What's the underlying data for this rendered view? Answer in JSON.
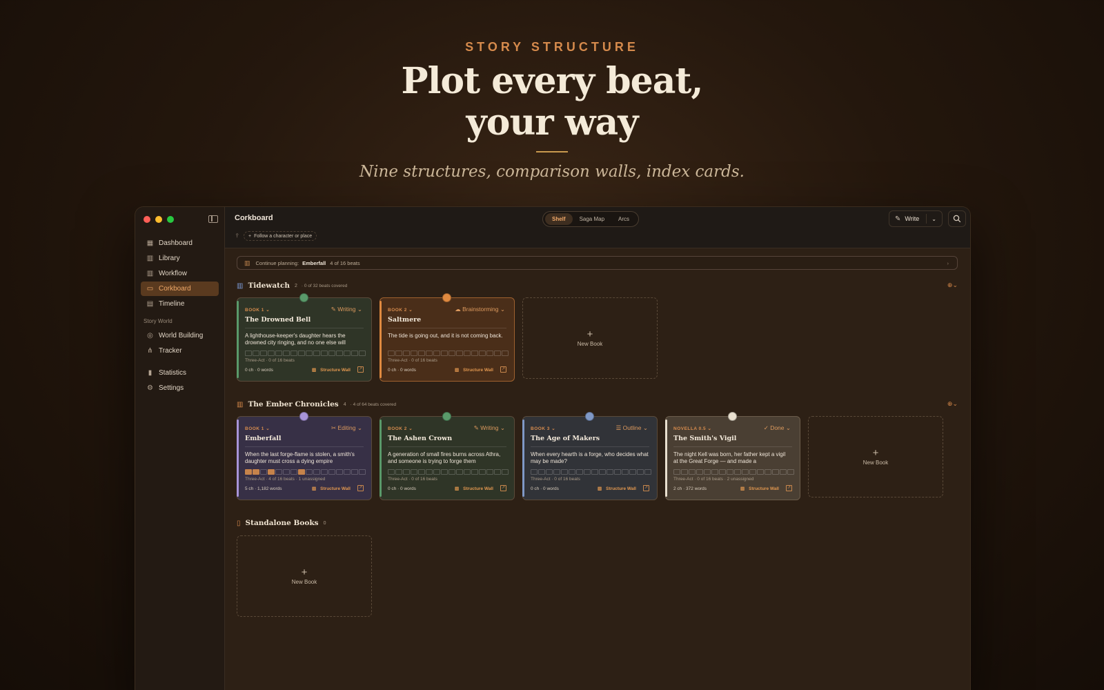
{
  "hero": {
    "eyebrow": "STORY STRUCTURE",
    "headline_line1": "Plot every beat,",
    "headline_line2": "your way",
    "tagline": "Nine structures, comparison walls, index cards."
  },
  "colors": {
    "accent": "#d58a4c",
    "traffic_red": "#ff5f57",
    "traffic_yellow": "#febc2e",
    "traffic_green": "#28c840"
  },
  "sidebar": {
    "items": [
      {
        "label": "Dashboard",
        "icon": "grid-icon"
      },
      {
        "label": "Library",
        "icon": "books-icon"
      },
      {
        "label": "Workflow",
        "icon": "columns-icon"
      },
      {
        "label": "Corkboard",
        "icon": "cards-icon",
        "active": true
      },
      {
        "label": "Timeline",
        "icon": "timeline-icon"
      }
    ],
    "section_label": "Story World",
    "world_items": [
      {
        "label": "World Building",
        "icon": "globe-icon"
      },
      {
        "label": "Tracker",
        "icon": "graph-icon"
      }
    ],
    "bottom_items": [
      {
        "label": "Statistics",
        "icon": "bar-chart-icon"
      },
      {
        "label": "Settings",
        "icon": "gear-icon"
      }
    ]
  },
  "topbar": {
    "title": "Corkboard",
    "tabs": [
      "Shelf",
      "Saga Map",
      "Arcs"
    ],
    "active_tab": "Shelf",
    "write_label": "Write",
    "follow_chip": "Follow a character or place"
  },
  "continue": {
    "prefix": "Continue planning:",
    "book": "Emberfall",
    "progress": "4 of 16 beats"
  },
  "series": [
    {
      "title": "Tidewatch",
      "count": "2",
      "coverage": "· 0 of 32 beats covered",
      "books": [
        {
          "book": "BOOK 1",
          "status": "Writing",
          "title": "The Drowned Bell",
          "desc": "A lighthouse-keeper's daughter hears the drowned city ringing, and no one else will",
          "meta": "Three-Act · 0 of 16 beats",
          "stats": "0 ch · 0 words",
          "wall": "Structure Wall",
          "dot": "#5a9a6a",
          "beats_done": 0
        },
        {
          "book": "BOOK 2",
          "status": "Brainstorming",
          "title": "Saltmere",
          "desc": "The tide is going out, and it is not coming back.",
          "meta": "Three-Act · 0 of 16 beats",
          "stats": "0 ch · 0 words",
          "wall": "Structure Wall",
          "dot": "#e08a40",
          "beats_done": 0
        }
      ],
      "new_book": "New Book"
    },
    {
      "title": "The Ember Chronicles",
      "count": "4",
      "coverage": "· 4 of 64 beats covered",
      "books": [
        {
          "book": "BOOK 1",
          "status": "Editing",
          "title": "Emberfall",
          "desc": "When the last forge-flame is stolen, a smith's daughter must cross a dying empire",
          "meta": "Three-Act · 4 of 16 beats · 1 unassigned",
          "stats": "5 ch · 1,182 words",
          "wall": "Structure Wall",
          "dot": "#a894d8",
          "beats_done": 4
        },
        {
          "book": "BOOK 2",
          "status": "Writing",
          "title": "The Ashen Crown",
          "desc": "A generation of small fires burns across Athra, and someone is trying to forge them",
          "meta": "Three-Act · 0 of 16 beats",
          "stats": "0 ch · 0 words",
          "wall": "Structure Wall",
          "dot": "#5a9a6a",
          "beats_done": 0
        },
        {
          "book": "BOOK 3",
          "status": "Outline",
          "title": "The Age of Makers",
          "desc": "When every hearth is a forge, who decides what may be made?",
          "meta": "Three-Act · 0 of 16 beats",
          "stats": "0 ch · 0 words",
          "wall": "Structure Wall",
          "dot": "#7f98c6",
          "beats_done": 0
        },
        {
          "book": "NOVELLA 0.5",
          "status": "Done",
          "title": "The Smith's Vigil",
          "desc": "The night Kell was born, her father kept a vigil at the Great Forge — and made a",
          "meta": "Three-Act · 0 of 16 beats · 2 unassigned",
          "stats": "2 ch · 372 words",
          "wall": "Structure Wall",
          "dot": "#e9e0cf",
          "beats_done": 0
        }
      ],
      "new_book": "New Book"
    }
  ],
  "standalone": {
    "title": "Standalone Books",
    "count": "0",
    "new_book": "New Book"
  }
}
